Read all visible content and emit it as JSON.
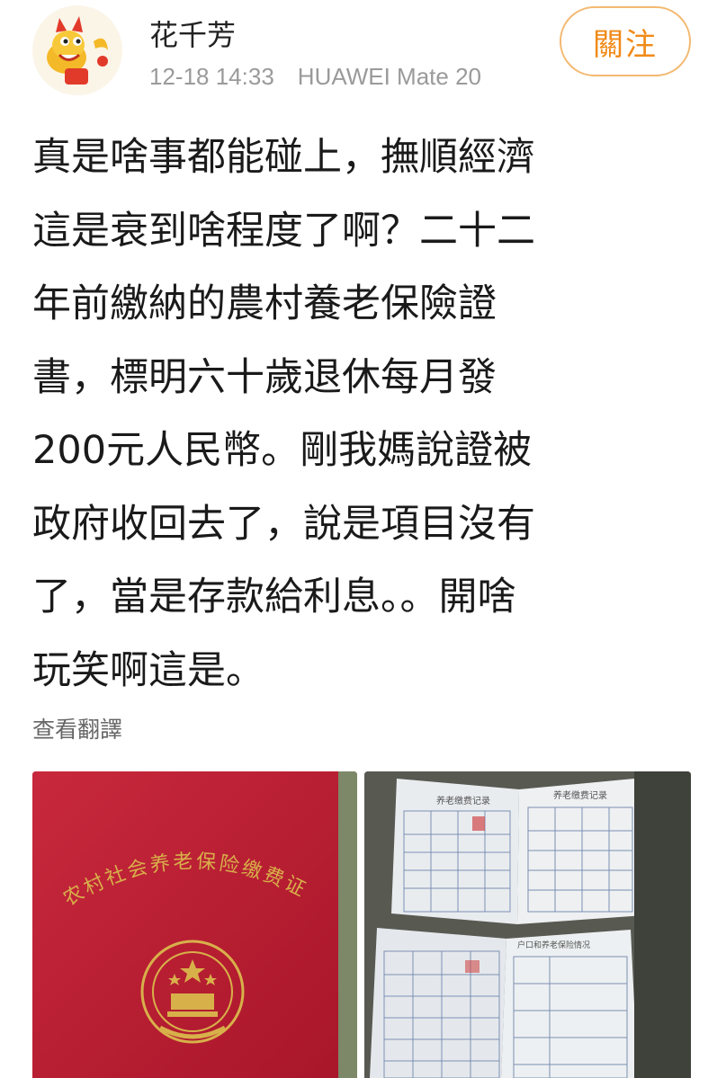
{
  "post": {
    "author": "花千芳",
    "timestamp": "12-18 14:33",
    "device": "HUAWEI Mate 20",
    "follow_label": "關注",
    "text_lines": [
      "真是啥事都能碰上，撫順經濟",
      "這是衰到啥程度了啊？二十二",
      "年前繳納的農村養老保險證",
      "書，標明六十歲退休每月發",
      "200元人民幣。剛我媽說證被",
      "政府收回去了，說是項目沒有",
      "了，當是存款給利息。。開啥",
      "玩笑啊這是。"
    ],
    "translate_label": "查看翻譯"
  },
  "photos": [
    {
      "caption": "农村社会养老保险缴费证"
    },
    {
      "left_page_title": "养老缴费记录",
      "right_page_title": "养老缴费记录",
      "lower_right_title": "户口和养老保险情况"
    }
  ],
  "colors": {
    "follow_accent": "#f18a17",
    "certificate_red": "#c01c30",
    "gold": "#d8b04a"
  }
}
